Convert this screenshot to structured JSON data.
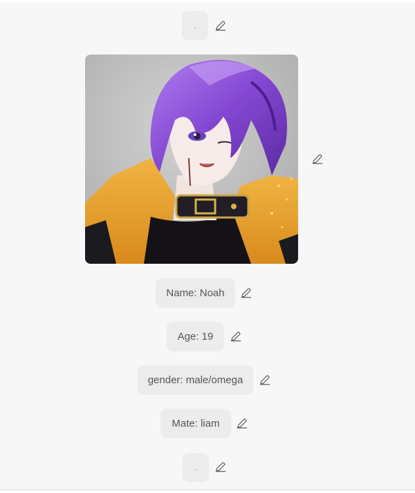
{
  "colors": {
    "page_background": "#f7f7f7",
    "chip_background": "#ececec",
    "chip_text": "#555555",
    "icon": "#5c5c5c",
    "hair_purple": "#8b48d6",
    "jacket_orange": "#e9a634",
    "image_background": "#bdbdbd"
  },
  "profile": {
    "top_field": {
      "value": ".",
      "edit_icon": "pencil-icon"
    },
    "avatar": {
      "description_icon": "portrait-image",
      "edit_icon": "pencil-icon"
    },
    "fields": [
      {
        "label": "Name: Noah",
        "edit_icon": "pencil-icon"
      },
      {
        "label": "Age: 19",
        "edit_icon": "pencil-icon"
      },
      {
        "label": "gender: male/omega",
        "edit_icon": "pencil-icon"
      },
      {
        "label": "Mate: liam",
        "edit_icon": "pencil-icon"
      }
    ],
    "bottom_field": {
      "value": ".",
      "edit_icon": "pencil-icon"
    }
  }
}
